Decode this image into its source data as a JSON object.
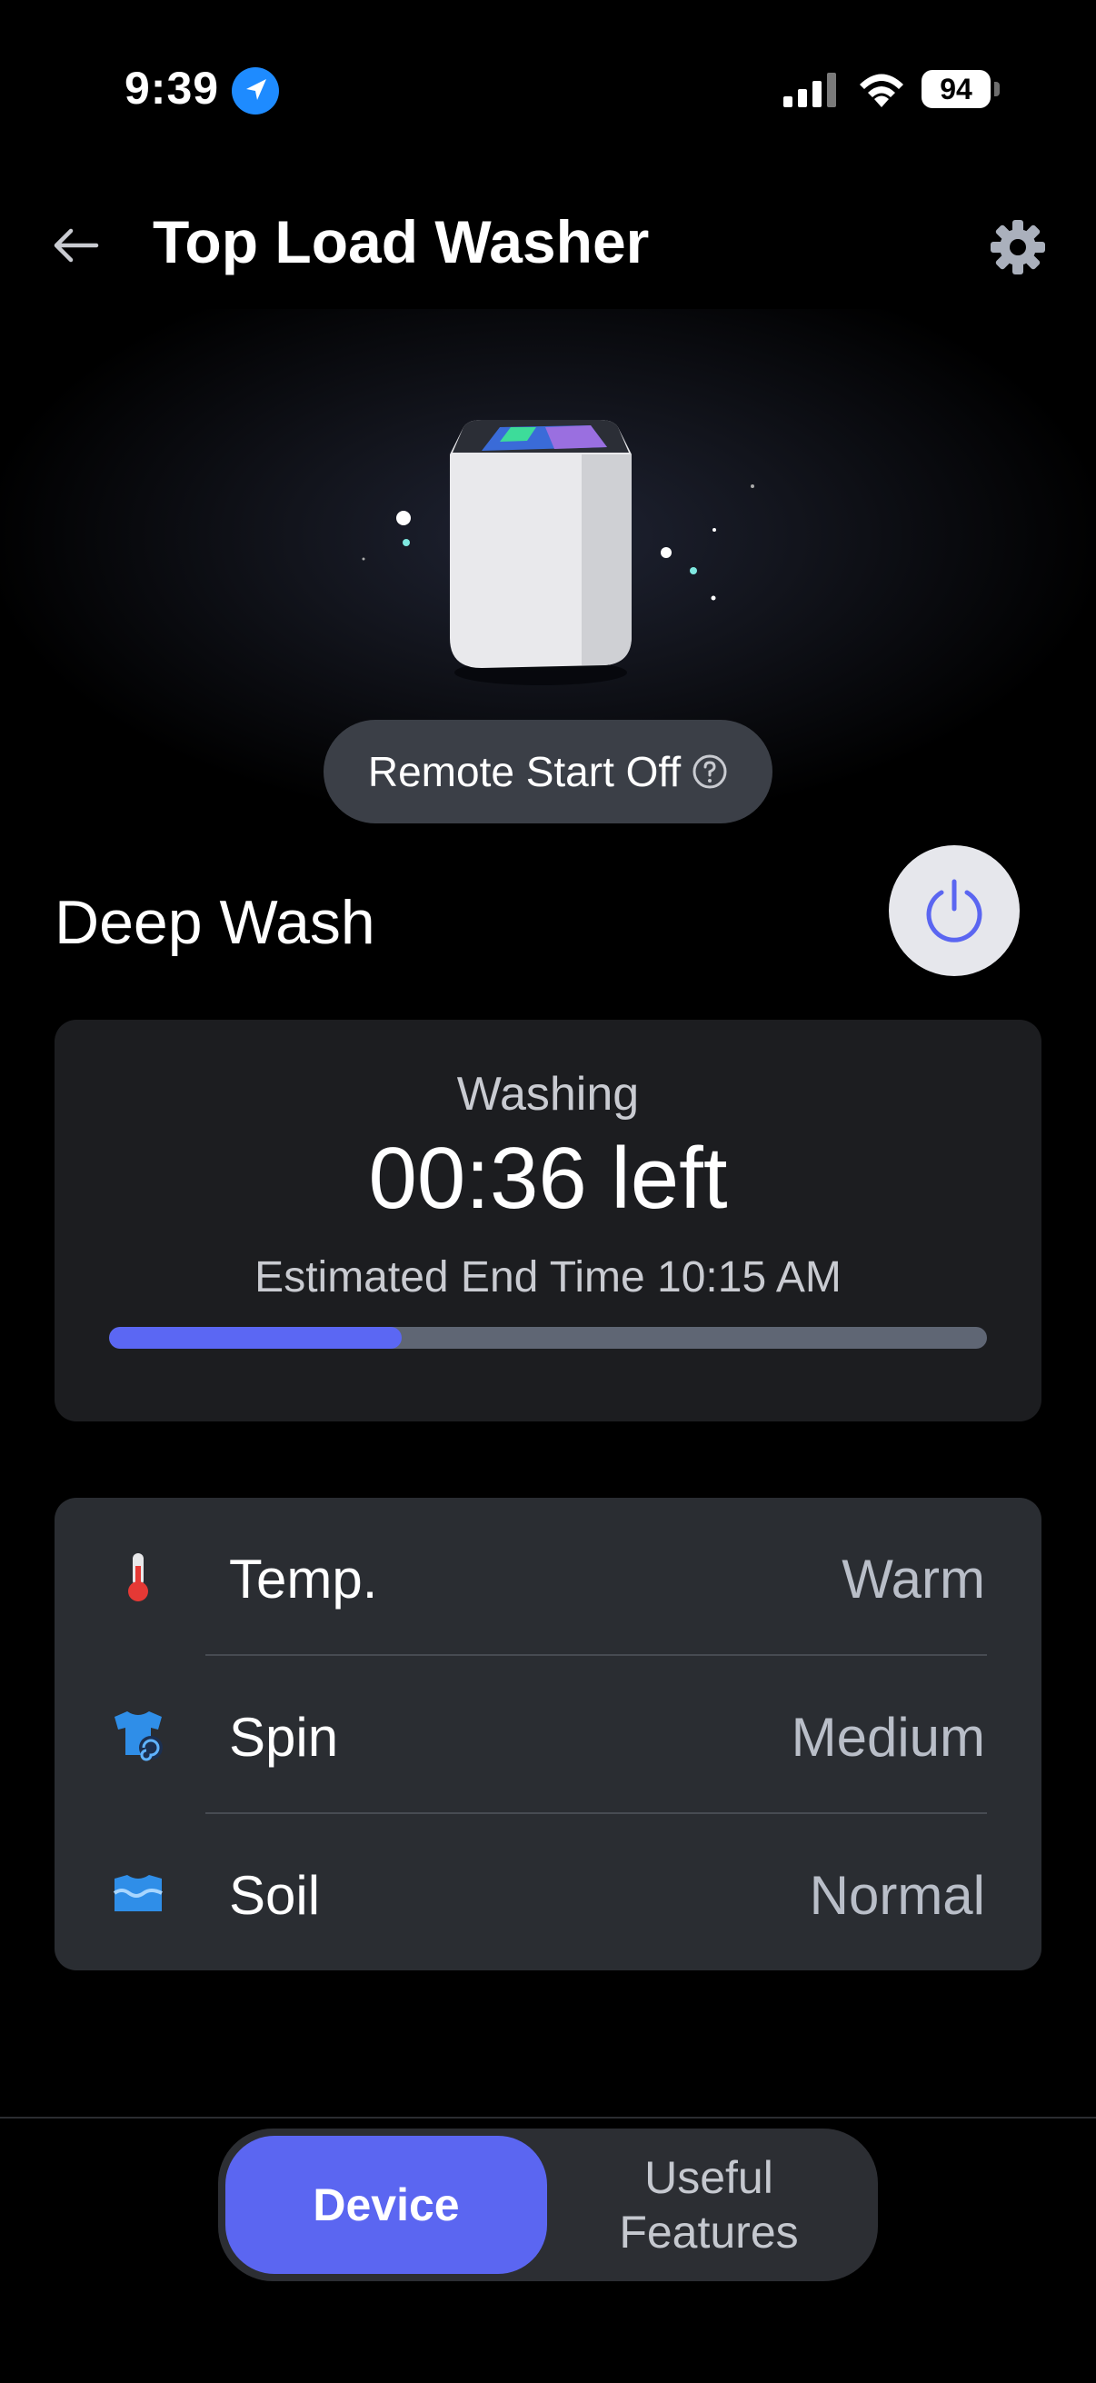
{
  "status_bar": {
    "time": "9:39",
    "battery": "94"
  },
  "header": {
    "title": "Top Load Washer"
  },
  "hero": {
    "remote_start": "Remote Start Off"
  },
  "cycle": {
    "name": "Deep Wash"
  },
  "status": {
    "state": "Washing",
    "time_left": "00:36 left",
    "end_time": "Estimated End Time 10:15 AM",
    "progress": 0.333
  },
  "settings": [
    {
      "label": "Temp.",
      "value": "Warm",
      "icon": "thermometer-icon"
    },
    {
      "label": "Spin",
      "value": "Medium",
      "icon": "spin-shirt-icon"
    },
    {
      "label": "Soil",
      "value": "Normal",
      "icon": "soil-icon"
    }
  ],
  "nav": {
    "device": "Device",
    "features": "Useful Features"
  },
  "colors": {
    "accent": "#5b66f1",
    "card": "#1c1d20",
    "settings_card": "#2a2d32",
    "track": "#5f6674"
  }
}
